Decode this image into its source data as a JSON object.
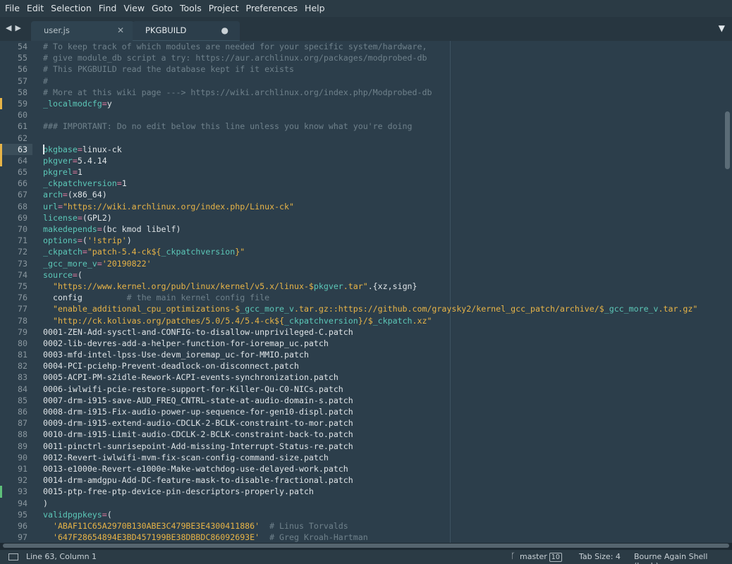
{
  "menu": [
    "File",
    "Edit",
    "Selection",
    "Find",
    "View",
    "Goto",
    "Tools",
    "Project",
    "Preferences",
    "Help"
  ],
  "tabs": [
    {
      "label": "user.js",
      "active": false,
      "dirty": false
    },
    {
      "label": "PKGBUILD",
      "active": true,
      "dirty": true
    }
  ],
  "icons": {
    "nav_back": "◀",
    "nav_forward": "▶",
    "tab_close": "✕",
    "tab_dirty": "●",
    "tab_menu": "▼",
    "branch": "ᚴ"
  },
  "gutter": {
    "modified_color": "#e8b447",
    "added_color": "#5ec07a"
  },
  "editor": {
    "active_line": 63,
    "lines": [
      {
        "n": "54",
        "mark": "",
        "tokens": [
          {
            "t": "# To keep track of which modules are needed for your specific system/hardware,",
            "c": "comment"
          }
        ]
      },
      {
        "n": "55",
        "mark": "",
        "tokens": [
          {
            "t": "# give module_db script a try: https://aur.archlinux.org/packages/modprobed-db",
            "c": "comment"
          }
        ]
      },
      {
        "n": "56",
        "mark": "",
        "tokens": [
          {
            "t": "# This PKGBUILD read the database kept if it exists",
            "c": "comment"
          }
        ]
      },
      {
        "n": "57",
        "mark": "",
        "tokens": [
          {
            "t": "#",
            "c": "comment"
          }
        ]
      },
      {
        "n": "58",
        "mark": "",
        "tokens": [
          {
            "t": "# More at this wiki page ---> https://wiki.archlinux.org/index.php/Modprobed-db",
            "c": "comment"
          }
        ]
      },
      {
        "n": "59",
        "mark": "mod",
        "tokens": [
          {
            "t": "_localmodcfg",
            "c": "var"
          },
          {
            "t": "=",
            "c": "op"
          },
          {
            "t": "y",
            "c": "plain"
          }
        ]
      },
      {
        "n": "60",
        "mark": "",
        "tokens": []
      },
      {
        "n": "61",
        "mark": "",
        "tokens": [
          {
            "t": "### IMPORTANT: Do no edit below this line unless you know what you're doing",
            "c": "comment"
          }
        ]
      },
      {
        "n": "62",
        "mark": "",
        "tokens": []
      },
      {
        "n": "63",
        "mark": "mod",
        "tokens": [
          {
            "t": "pkgbase",
            "c": "var"
          },
          {
            "t": "=",
            "c": "op"
          },
          {
            "t": "linux-ck",
            "c": "plain"
          }
        ]
      },
      {
        "n": "64",
        "mark": "mod",
        "tokens": [
          {
            "t": "pkgver",
            "c": "var"
          },
          {
            "t": "=",
            "c": "op"
          },
          {
            "t": "5.4.14",
            "c": "plain"
          }
        ]
      },
      {
        "n": "65",
        "mark": "",
        "tokens": [
          {
            "t": "pkgrel",
            "c": "var"
          },
          {
            "t": "=",
            "c": "op"
          },
          {
            "t": "1",
            "c": "plain"
          }
        ]
      },
      {
        "n": "66",
        "mark": "",
        "tokens": [
          {
            "t": "_ckpatchversion",
            "c": "var"
          },
          {
            "t": "=",
            "c": "op"
          },
          {
            "t": "1",
            "c": "plain"
          }
        ]
      },
      {
        "n": "67",
        "mark": "",
        "tokens": [
          {
            "t": "arch",
            "c": "var"
          },
          {
            "t": "=",
            "c": "op"
          },
          {
            "t": "(x86_64)",
            "c": "plain"
          }
        ]
      },
      {
        "n": "68",
        "mark": "",
        "tokens": [
          {
            "t": "url",
            "c": "var"
          },
          {
            "t": "=",
            "c": "op"
          },
          {
            "t": "\"https://wiki.archlinux.org/index.php/Linux-ck\"",
            "c": "str"
          }
        ]
      },
      {
        "n": "69",
        "mark": "",
        "tokens": [
          {
            "t": "license",
            "c": "var"
          },
          {
            "t": "=",
            "c": "op"
          },
          {
            "t": "(GPL2)",
            "c": "plain"
          }
        ]
      },
      {
        "n": "70",
        "mark": "",
        "tokens": [
          {
            "t": "makedepends",
            "c": "var"
          },
          {
            "t": "=",
            "c": "op"
          },
          {
            "t": "(bc kmod libelf)",
            "c": "plain"
          }
        ]
      },
      {
        "n": "71",
        "mark": "",
        "tokens": [
          {
            "t": "options",
            "c": "var"
          },
          {
            "t": "=",
            "c": "op"
          },
          {
            "t": "(",
            "c": "plain"
          },
          {
            "t": "'!strip'",
            "c": "str"
          },
          {
            "t": ")",
            "c": "plain"
          }
        ]
      },
      {
        "n": "72",
        "mark": "",
        "tokens": [
          {
            "t": "_ckpatch",
            "c": "var"
          },
          {
            "t": "=",
            "c": "op"
          },
          {
            "t": "\"patch-5.4-ck${",
            "c": "str"
          },
          {
            "t": "_ckpatchversion",
            "c": "var"
          },
          {
            "t": "}\"",
            "c": "str"
          }
        ]
      },
      {
        "n": "73",
        "mark": "",
        "tokens": [
          {
            "t": "_gcc_more_v",
            "c": "var"
          },
          {
            "t": "=",
            "c": "op"
          },
          {
            "t": "'20190822'",
            "c": "str"
          }
        ]
      },
      {
        "n": "74",
        "mark": "",
        "tokens": [
          {
            "t": "source",
            "c": "var"
          },
          {
            "t": "=",
            "c": "op"
          },
          {
            "t": "(",
            "c": "plain"
          }
        ]
      },
      {
        "n": "75",
        "mark": "",
        "tokens": [
          {
            "t": "  \"https://www.kernel.org/pub/linux/kernel/v5.x/linux-$",
            "c": "str"
          },
          {
            "t": "pkgver",
            "c": "var"
          },
          {
            "t": ".tar\"",
            "c": "str"
          },
          {
            "t": ".{xz,sign}",
            "c": "plain"
          }
        ]
      },
      {
        "n": "76",
        "mark": "",
        "tokens": [
          {
            "t": "  config",
            "c": "plain"
          },
          {
            "t": "         # the main kernel config file",
            "c": "comment"
          }
        ]
      },
      {
        "n": "77",
        "mark": "",
        "tokens": [
          {
            "t": "  \"enable_additional_cpu_optimizations-$",
            "c": "str"
          },
          {
            "t": "_gcc_more_v",
            "c": "var"
          },
          {
            "t": ".tar.gz::https://github.com/graysky2/kernel_gcc_patch/archive/$",
            "c": "str"
          },
          {
            "t": "_gcc_more_v",
            "c": "var"
          },
          {
            "t": ".tar.gz\"",
            "c": "str"
          }
        ]
      },
      {
        "n": "78",
        "mark": "",
        "tokens": [
          {
            "t": "  \"http://ck.kolivas.org/patches/5.0/5.4/5.4-ck${",
            "c": "str"
          },
          {
            "t": "_ckpatchversion",
            "c": "var"
          },
          {
            "t": "}/$",
            "c": "str"
          },
          {
            "t": "_ckpatch",
            "c": "var"
          },
          {
            "t": ".xz\"",
            "c": "str"
          }
        ]
      },
      {
        "n": "79",
        "mark": "",
        "tokens": [
          {
            "t": "0001-ZEN-Add-sysctl-and-CONFIG-to-disallow-unprivileged-C.patch",
            "c": "plain"
          }
        ]
      },
      {
        "n": "80",
        "mark": "",
        "tokens": [
          {
            "t": "0002-lib-devres-add-a-helper-function-for-ioremap_uc.patch",
            "c": "plain"
          }
        ]
      },
      {
        "n": "81",
        "mark": "",
        "tokens": [
          {
            "t": "0003-mfd-intel-lpss-Use-devm_ioremap_uc-for-MMIO.patch",
            "c": "plain"
          }
        ]
      },
      {
        "n": "82",
        "mark": "",
        "tokens": [
          {
            "t": "0004-PCI-pciehp-Prevent-deadlock-on-disconnect.patch",
            "c": "plain"
          }
        ]
      },
      {
        "n": "83",
        "mark": "",
        "tokens": [
          {
            "t": "0005-ACPI-PM-s2idle-Rework-ACPI-events-synchronization.patch",
            "c": "plain"
          }
        ]
      },
      {
        "n": "84",
        "mark": "",
        "tokens": [
          {
            "t": "0006-iwlwifi-pcie-restore-support-for-Killer-Qu-C0-NICs.patch",
            "c": "plain"
          }
        ]
      },
      {
        "n": "85",
        "mark": "",
        "tokens": [
          {
            "t": "0007-drm-i915-save-AUD_FREQ_CNTRL-state-at-audio-domain-s.patch",
            "c": "plain"
          }
        ]
      },
      {
        "n": "86",
        "mark": "",
        "tokens": [
          {
            "t": "0008-drm-i915-Fix-audio-power-up-sequence-for-gen10-displ.patch",
            "c": "plain"
          }
        ]
      },
      {
        "n": "87",
        "mark": "",
        "tokens": [
          {
            "t": "0009-drm-i915-extend-audio-CDCLK-2-BCLK-constraint-to-mor.patch",
            "c": "plain"
          }
        ]
      },
      {
        "n": "88",
        "mark": "",
        "tokens": [
          {
            "t": "0010-drm-i915-Limit-audio-CDCLK-2-BCLK-constraint-back-to.patch",
            "c": "plain"
          }
        ]
      },
      {
        "n": "89",
        "mark": "",
        "tokens": [
          {
            "t": "0011-pinctrl-sunrisepoint-Add-missing-Interrupt-Status-re.patch",
            "c": "plain"
          }
        ]
      },
      {
        "n": "90",
        "mark": "",
        "tokens": [
          {
            "t": "0012-Revert-iwlwifi-mvm-fix-scan-config-command-size.patch",
            "c": "plain"
          }
        ]
      },
      {
        "n": "91",
        "mark": "",
        "tokens": [
          {
            "t": "0013-e1000e-Revert-e1000e-Make-watchdog-use-delayed-work.patch",
            "c": "plain"
          }
        ]
      },
      {
        "n": "92",
        "mark": "",
        "tokens": [
          {
            "t": "0014-drm-amdgpu-Add-DC-feature-mask-to-disable-fractional.patch",
            "c": "plain"
          }
        ]
      },
      {
        "n": "93",
        "mark": "add",
        "tokens": [
          {
            "t": "0015-ptp-free-ptp-device-pin-descriptors-properly.patch",
            "c": "plain"
          }
        ]
      },
      {
        "n": "94",
        "mark": "",
        "tokens": [
          {
            "t": ")",
            "c": "plain"
          }
        ]
      },
      {
        "n": "95",
        "mark": "",
        "tokens": [
          {
            "t": "validpgpkeys",
            "c": "var"
          },
          {
            "t": "=",
            "c": "op"
          },
          {
            "t": "(",
            "c": "plain"
          }
        ]
      },
      {
        "n": "96",
        "mark": "",
        "tokens": [
          {
            "t": "  'ABAF11C65A2970B130ABE3C479BE3E4300411886'",
            "c": "str"
          },
          {
            "t": "  # Linus Torvalds",
            "c": "comment"
          }
        ]
      },
      {
        "n": "97",
        "mark": "",
        "tokens": [
          {
            "t": "  '647F28654894E3BD457199BE38DBBDC86092693E'",
            "c": "str"
          },
          {
            "t": "  # Greg Kroah-Hartman",
            "c": "comment"
          }
        ]
      }
    ]
  },
  "status": {
    "position": "Line 63, Column 1",
    "branch": "master",
    "branch_count": "10",
    "tab_size": "Tab Size: 4",
    "syntax": "Bourne Again Shell (bash)"
  }
}
